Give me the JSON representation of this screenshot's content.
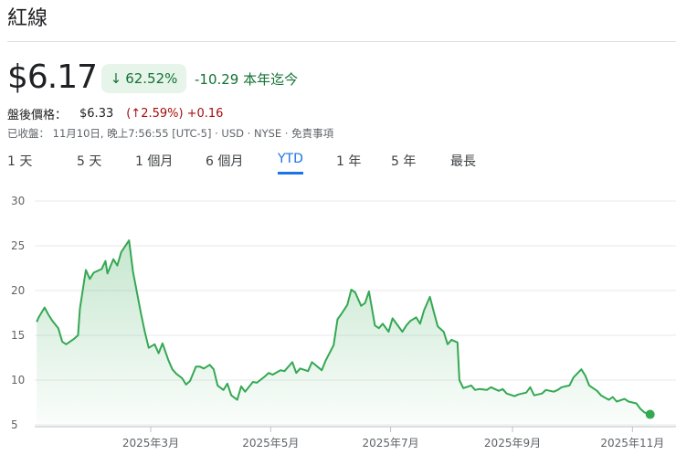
{
  "stock": {
    "name": "紅線",
    "price": "$6.17",
    "change_arrow": "↓",
    "change_pct": "62.52%",
    "change_abs": "-10.29 本年迄今",
    "after_hours_label": "盤後價格：",
    "after_hours_price": "$6.33",
    "after_hours_pct": "(↑2.59%)",
    "after_hours_abs": "+0.16",
    "closed_info": "已收盤： 11月10日, 晚上7:56:55 [UTC-5] · USD · NYSE · 免責事項",
    "accent_color": "#34a853",
    "line_color": "#34a853"
  },
  "ranges": [
    "1 天",
    "5 天",
    "1 個月",
    "6 個月",
    "YTD",
    "1 年",
    "5 年",
    "最長"
  ],
  "active_range": "YTD",
  "chart_data": {
    "type": "area",
    "title": "",
    "xlabel": "",
    "ylabel": "",
    "ylim": [
      5,
      30
    ],
    "y_ticks": [
      5,
      10,
      15,
      20,
      25,
      30
    ],
    "x_tick_labels": [
      "2025年3月",
      "2025年5月",
      "2025年7月",
      "2025年9月",
      "2025年11月"
    ],
    "x_tick_dates": [
      "2025-03-01",
      "2025-05-01",
      "2025-07-01",
      "2025-09-01",
      "2025-11-01"
    ],
    "grid": true,
    "series": [
      {
        "points": [
          [
            "2025-01-02",
            16.5
          ],
          [
            "2025-01-03",
            17.0
          ],
          [
            "2025-01-06",
            18.1
          ],
          [
            "2025-01-08",
            17.3
          ],
          [
            "2025-01-10",
            16.6
          ],
          [
            "2025-01-13",
            15.8
          ],
          [
            "2025-01-15",
            14.3
          ],
          [
            "2025-01-17",
            14.0
          ],
          [
            "2025-01-21",
            14.6
          ],
          [
            "2025-01-23",
            15.0
          ],
          [
            "2025-01-24",
            18.0
          ],
          [
            "2025-01-27",
            22.3
          ],
          [
            "2025-01-29",
            21.3
          ],
          [
            "2025-01-31",
            22.0
          ],
          [
            "2025-02-04",
            22.4
          ],
          [
            "2025-02-06",
            23.3
          ],
          [
            "2025-02-07",
            21.9
          ],
          [
            "2025-02-10",
            23.5
          ],
          [
            "2025-02-12",
            22.8
          ],
          [
            "2025-02-14",
            24.3
          ],
          [
            "2025-02-18",
            25.6
          ],
          [
            "2025-02-20",
            22.1
          ],
          [
            "2025-02-24",
            17.5
          ],
          [
            "2025-02-26",
            15.4
          ],
          [
            "2025-02-28",
            13.6
          ],
          [
            "2025-03-03",
            14.0
          ],
          [
            "2025-03-05",
            13.0
          ],
          [
            "2025-03-07",
            14.1
          ],
          [
            "2025-03-10",
            12.2
          ],
          [
            "2025-03-12",
            11.2
          ],
          [
            "2025-03-14",
            10.7
          ],
          [
            "2025-03-17",
            10.2
          ],
          [
            "2025-03-19",
            9.5
          ],
          [
            "2025-03-21",
            9.9
          ],
          [
            "2025-03-24",
            11.5
          ],
          [
            "2025-03-26",
            11.5
          ],
          [
            "2025-03-28",
            11.3
          ],
          [
            "2025-03-31",
            11.7
          ],
          [
            "2025-04-02",
            11.2
          ],
          [
            "2025-04-04",
            9.4
          ],
          [
            "2025-04-07",
            8.9
          ],
          [
            "2025-04-09",
            9.6
          ],
          [
            "2025-04-11",
            8.3
          ],
          [
            "2025-04-14",
            7.8
          ],
          [
            "2025-04-16",
            9.3
          ],
          [
            "2025-04-18",
            8.7
          ],
          [
            "2025-04-22",
            9.8
          ],
          [
            "2025-04-24",
            9.7
          ],
          [
            "2025-04-28",
            10.4
          ],
          [
            "2025-04-30",
            10.8
          ],
          [
            "2025-05-02",
            10.6
          ],
          [
            "2025-05-06",
            11.1
          ],
          [
            "2025-05-08",
            11.0
          ],
          [
            "2025-05-12",
            12.0
          ],
          [
            "2025-05-14",
            10.8
          ],
          [
            "2025-05-16",
            11.3
          ],
          [
            "2025-05-20",
            11.0
          ],
          [
            "2025-05-22",
            12.0
          ],
          [
            "2025-05-27",
            11.1
          ],
          [
            "2025-05-29",
            12.2
          ],
          [
            "2025-06-02",
            13.9
          ],
          [
            "2025-06-04",
            16.8
          ],
          [
            "2025-06-06",
            17.4
          ],
          [
            "2025-06-09",
            18.4
          ],
          [
            "2025-06-11",
            20.1
          ],
          [
            "2025-06-13",
            19.8
          ],
          [
            "2025-06-16",
            18.3
          ],
          [
            "2025-06-18",
            18.6
          ],
          [
            "2025-06-20",
            19.9
          ],
          [
            "2025-06-23",
            16.1
          ],
          [
            "2025-06-25",
            15.8
          ],
          [
            "2025-06-27",
            16.3
          ],
          [
            "2025-06-30",
            15.4
          ],
          [
            "2025-07-02",
            16.9
          ],
          [
            "2025-07-07",
            15.4
          ],
          [
            "2025-07-09",
            16.1
          ],
          [
            "2025-07-11",
            16.6
          ],
          [
            "2025-07-14",
            17.0
          ],
          [
            "2025-07-16",
            16.3
          ],
          [
            "2025-07-18",
            17.8
          ],
          [
            "2025-07-21",
            19.3
          ],
          [
            "2025-07-23",
            17.6
          ],
          [
            "2025-07-25",
            16.0
          ],
          [
            "2025-07-28",
            15.4
          ],
          [
            "2025-07-30",
            14.0
          ],
          [
            "2025-08-01",
            14.5
          ],
          [
            "2025-08-04",
            14.2
          ],
          [
            "2025-08-05",
            10.0
          ],
          [
            "2025-08-07",
            9.1
          ],
          [
            "2025-08-11",
            9.4
          ],
          [
            "2025-08-13",
            8.9
          ],
          [
            "2025-08-15",
            9.0
          ],
          [
            "2025-08-19",
            8.9
          ],
          [
            "2025-08-21",
            9.2
          ],
          [
            "2025-08-25",
            8.8
          ],
          [
            "2025-08-27",
            9.0
          ],
          [
            "2025-08-29",
            8.5
          ],
          [
            "2025-09-02",
            8.2
          ],
          [
            "2025-09-04",
            8.4
          ],
          [
            "2025-09-08",
            8.6
          ],
          [
            "2025-09-10",
            9.2
          ],
          [
            "2025-09-12",
            8.3
          ],
          [
            "2025-09-16",
            8.5
          ],
          [
            "2025-09-18",
            8.9
          ],
          [
            "2025-09-22",
            8.7
          ],
          [
            "2025-09-24",
            8.9
          ],
          [
            "2025-09-26",
            9.2
          ],
          [
            "2025-09-30",
            9.4
          ],
          [
            "2025-10-02",
            10.3
          ],
          [
            "2025-10-06",
            11.2
          ],
          [
            "2025-10-08",
            10.5
          ],
          [
            "2025-10-10",
            9.4
          ],
          [
            "2025-10-14",
            8.8
          ],
          [
            "2025-10-16",
            8.3
          ],
          [
            "2025-10-20",
            7.8
          ],
          [
            "2025-10-22",
            8.1
          ],
          [
            "2025-10-24",
            7.6
          ],
          [
            "2025-10-28",
            7.9
          ],
          [
            "2025-10-30",
            7.6
          ],
          [
            "2025-11-03",
            7.4
          ],
          [
            "2025-11-05",
            6.8
          ],
          [
            "2025-11-07",
            6.4
          ],
          [
            "2025-11-10",
            6.17
          ]
        ]
      }
    ]
  }
}
